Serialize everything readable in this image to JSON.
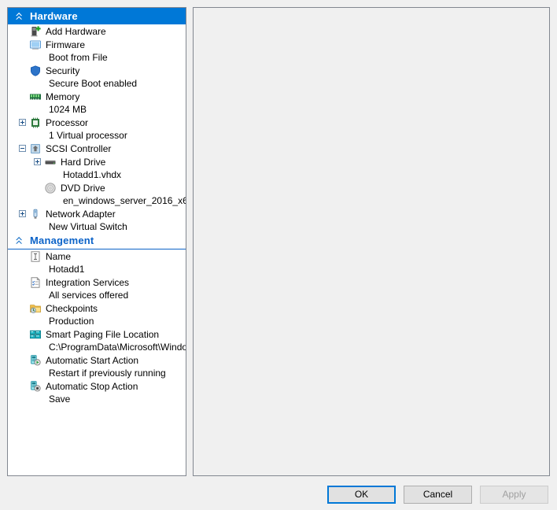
{
  "dialog": {
    "sections": [
      {
        "id": "hardware",
        "header": {
          "label": "Hardware",
          "icon": "chevron-double-up-icon",
          "style": "blue"
        },
        "nodes": [
          {
            "label": "Add Hardware",
            "icon": "add-hardware-icon",
            "expander": "none",
            "indent": 0,
            "sub": null
          },
          {
            "label": "Firmware",
            "icon": "firmware-monitor-icon",
            "expander": "none",
            "indent": 0,
            "sub": "Boot from File"
          },
          {
            "label": "Security",
            "icon": "security-shield-icon",
            "expander": "none",
            "indent": 0,
            "sub": "Secure Boot enabled"
          },
          {
            "label": "Memory",
            "icon": "memory-dimm-icon",
            "expander": "none",
            "indent": 0,
            "sub": "1024 MB"
          },
          {
            "label": "Processor",
            "icon": "processor-chip-icon",
            "expander": "plus",
            "indent": 0,
            "sub": "1 Virtual processor"
          },
          {
            "label": "SCSI Controller",
            "icon": "scsi-controller-icon",
            "expander": "minus",
            "indent": 0,
            "sub": null
          },
          {
            "label": "Hard Drive",
            "icon": "hard-drive-icon",
            "expander": "plus",
            "indent": 1,
            "sub": "Hotadd1.vhdx"
          },
          {
            "label": "DVD Drive",
            "icon": "dvd-drive-icon",
            "expander": "none",
            "indent": 1,
            "sub": "en_windows_server_2016_x6…"
          },
          {
            "label": "Network Adapter",
            "icon": "network-adapter-icon",
            "expander": "plus",
            "indent": 0,
            "sub": "New Virtual Switch"
          }
        ]
      },
      {
        "id": "management",
        "header": {
          "label": "Management",
          "icon": "chevron-double-up-icon",
          "style": "white"
        },
        "nodes": [
          {
            "label": "Name",
            "icon": "name-text-icon",
            "expander": "none",
            "indent": 0,
            "sub": "Hotadd1"
          },
          {
            "label": "Integration Services",
            "icon": "integration-services-icon",
            "expander": "none",
            "indent": 0,
            "sub": "All services offered"
          },
          {
            "label": "Checkpoints",
            "icon": "checkpoints-icon",
            "expander": "none",
            "indent": 0,
            "sub": "Production"
          },
          {
            "label": "Smart Paging File Location",
            "icon": "smart-paging-icon",
            "expander": "none",
            "indent": 0,
            "sub": "C:\\ProgramData\\Microsoft\\Windo…"
          },
          {
            "label": "Automatic Start Action",
            "icon": "automatic-start-icon",
            "expander": "none",
            "indent": 0,
            "sub": "Restart if previously running"
          },
          {
            "label": "Automatic Stop Action",
            "icon": "automatic-stop-icon",
            "expander": "none",
            "indent": 0,
            "sub": "Save"
          }
        ]
      }
    ],
    "buttons": {
      "ok": "OK",
      "cancel": "Cancel",
      "apply": "Apply",
      "apply_disabled": true
    },
    "colors": {
      "accent": "#0078d7",
      "header_text_blue": "#0c63c8",
      "panel_background": "#f0f0f0",
      "tree_background": "#ffffff",
      "border": "#828790"
    }
  }
}
